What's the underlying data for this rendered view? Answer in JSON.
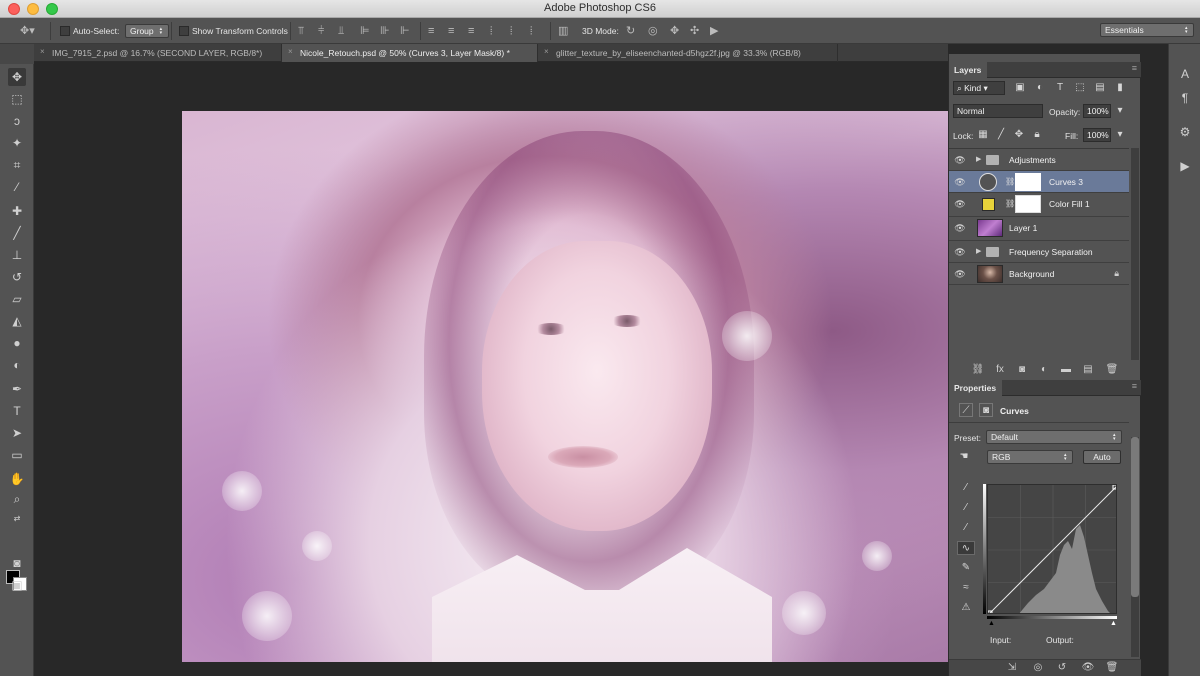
{
  "window": {
    "title": "Adobe Photoshop CS6",
    "workspace": "Essentials"
  },
  "options_bar": {
    "auto_select_label": "Auto-Select:",
    "auto_select_value": "Group",
    "transform_label": "Show Transform Controls",
    "mode_3d_label": "3D Mode:"
  },
  "tabs": [
    {
      "label": "IMG_7915_2.psd @ 16.7% (SECOND LAYER, RGB/8*)",
      "active": false
    },
    {
      "label": "Nicole_Retouch.psd @ 50% (Curves 3, Layer Mask/8) *",
      "active": true
    },
    {
      "label": "glitter_texture_by_eliseenchanted-d5hgz2f.jpg @ 33.3% (RGB/8)",
      "active": false
    }
  ],
  "layers_panel": {
    "title": "Layers",
    "filter_kind": "Kind",
    "blend_mode": "Normal",
    "opacity_label": "Opacity:",
    "opacity_value": "100%",
    "lock_label": "Lock:",
    "fill_label": "Fill:",
    "fill_value": "100%",
    "layers": [
      {
        "name": "Adjustments",
        "type": "group"
      },
      {
        "name": "Curves 3",
        "type": "adjustment",
        "active": true
      },
      {
        "name": "Color Fill 1",
        "type": "fill",
        "color": "#e8d33a"
      },
      {
        "name": "Layer 1",
        "type": "pixel"
      },
      {
        "name": "Frequency Separation",
        "type": "group"
      },
      {
        "name": "Background",
        "type": "background",
        "locked": true
      }
    ]
  },
  "properties_panel": {
    "title": "Properties",
    "adjustment_name": "Curves",
    "preset_label": "Preset:",
    "preset_value": "Default",
    "channel_value": "RGB",
    "auto_label": "Auto",
    "input_label": "Input:",
    "output_label": "Output:"
  },
  "colors": {
    "active_layer": "#6a7a99",
    "fill_swatch": "#e8d33a"
  }
}
